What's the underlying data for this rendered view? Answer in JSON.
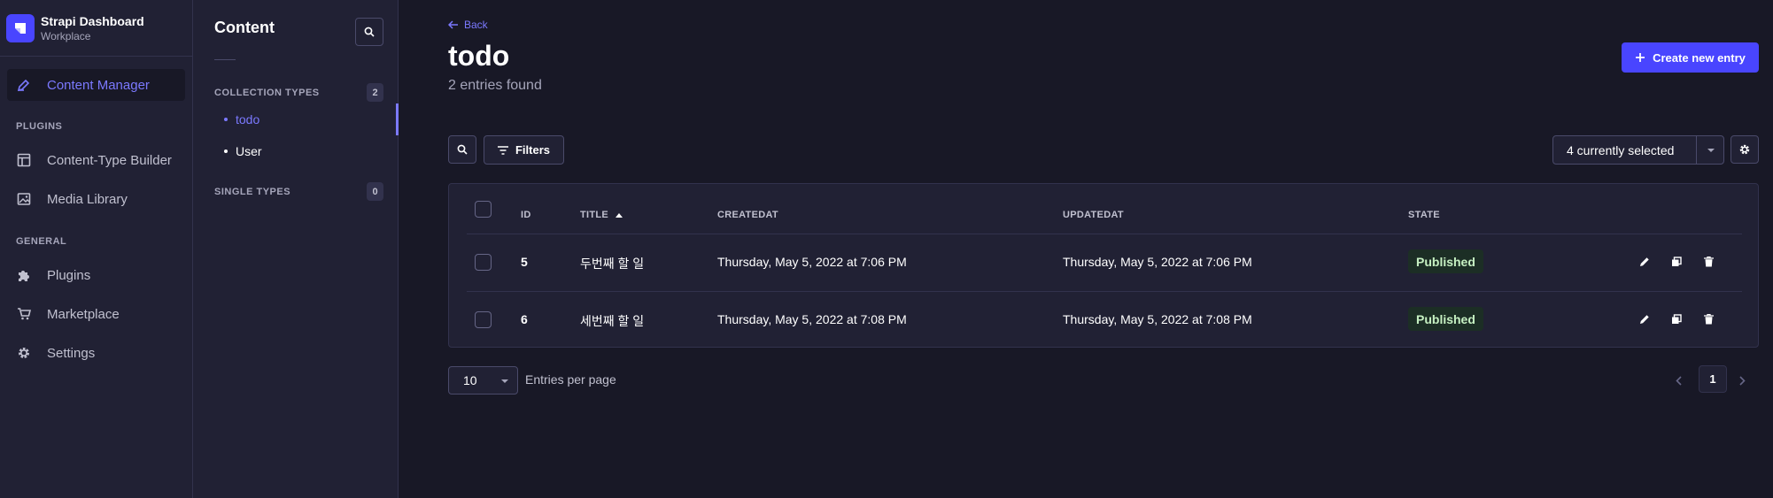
{
  "brand": {
    "title": "Strapi Dashboard",
    "subtitle": "Workplace"
  },
  "mainnav": {
    "content_manager": "Content Manager",
    "plugins_section": "PLUGINS",
    "content_type_builder": "Content-Type Builder",
    "media_library": "Media Library",
    "general_section": "GENERAL",
    "plugins": "Plugins",
    "marketplace": "Marketplace",
    "settings": "Settings"
  },
  "subnav": {
    "title": "Content",
    "collection_types": {
      "label": "COLLECTION TYPES",
      "count": "2",
      "items": [
        "todo",
        "User"
      ]
    },
    "single_types": {
      "label": "SINGLE TYPES",
      "count": "0"
    }
  },
  "header": {
    "back": "Back",
    "title": "todo",
    "subtitle": "2 entries found",
    "create_label": "Create new entry"
  },
  "toolbar": {
    "filters_label": "Filters",
    "columns_select": "4 currently selected"
  },
  "table": {
    "headers": {
      "id": "ID",
      "title": "TITLE",
      "createdat": "CREATEDAT",
      "updatedat": "UPDATEDAT",
      "state": "STATE"
    },
    "rows": [
      {
        "id": "5",
        "title": "두번째 할 일",
        "createdat": "Thursday, May 5, 2022 at 7:06 PM",
        "updatedat": "Thursday, May 5, 2022 at 7:06 PM",
        "state": "Published"
      },
      {
        "id": "6",
        "title": "세번째 할 일",
        "createdat": "Thursday, May 5, 2022 at 7:08 PM",
        "updatedat": "Thursday, May 5, 2022 at 7:08 PM",
        "state": "Published"
      }
    ]
  },
  "pagination": {
    "page_size": "10",
    "page_size_label": "Entries per page",
    "current_page": "1"
  },
  "colors": {
    "accent": "#7b79ff",
    "primary": "#4945ff",
    "background": "#181826",
    "surface": "#212134",
    "success_text": "#c6f0c2"
  }
}
